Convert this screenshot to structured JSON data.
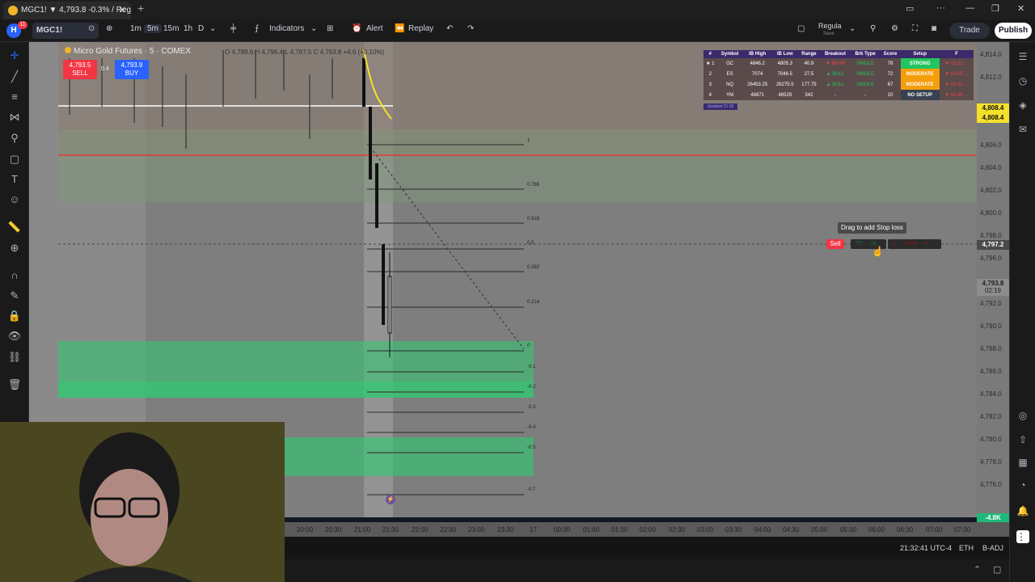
{
  "browser": {
    "tab_title": "MGC1! ▼ 4,793.8 -0.3% / Reg",
    "new_tab": "+",
    "close_tab": "✕"
  },
  "toolbar": {
    "notification_count": "11",
    "symbol": "MGC1!",
    "intervals": [
      "1m",
      "5m",
      "15m",
      "1h",
      "D"
    ],
    "active_interval": "5m",
    "indicators_label": "Indicators",
    "alert_label": "Alert",
    "replay_label": "Replay",
    "layout_name": "Regula",
    "layout_sub": "Save",
    "trade_label": "Trade",
    "publish_label": "Publish"
  },
  "chart_header": {
    "title": "Micro Gold Futures · 5 · COMEX",
    "ohlc": "O 4,789.6 H 4,796.4 L 4,787.5 C 4,793.8 +4.6 (+0.10%)",
    "sell_price": "4,793.5",
    "sell_label": "SELL",
    "spread": "0.4",
    "buy_price": "4,793.9",
    "buy_label": "BUY"
  },
  "ib_table": {
    "headers": [
      "#",
      "Symbol",
      "IB High",
      "IB Low",
      "Range",
      "Breakout",
      "Brk Type",
      "Score",
      "Setup",
      "F"
    ],
    "rows": [
      {
        "n": "★ 1",
        "symbol": "GC",
        "high": "4846.2",
        "low": "4805.3",
        "range": "40.9",
        "breakout": "▼ BEAR",
        "type": "SINGLE",
        "score": "78",
        "setup": "STRONG",
        "last": "▼ 13:31 ..."
      },
      {
        "n": "2",
        "symbol": "ES",
        "high": "7074",
        "low": "7046.5",
        "range": "27.5",
        "breakout": "▲ BULL",
        "type": "SINGLE",
        "score": "72",
        "setup": "MODERATE",
        "last": "▼ 13:05 ..."
      },
      {
        "n": "3",
        "symbol": "NQ",
        "high": "26453.25",
        "low": "26275.5",
        "range": "177.75",
        "breakout": "▲ BULL",
        "type": "SINGLE",
        "score": "67",
        "setup": "MODERATE",
        "last": "▼ 14:12 ..."
      },
      {
        "n": "4",
        "symbol": "YM",
        "high": "48871",
        "low": "48529",
        "range": "342",
        "breakout": "-",
        "type": "-",
        "score": "10",
        "setup": "NO SETUP",
        "last": "▼ 13:46 ..."
      }
    ],
    "updated": "Updated 21:32"
  },
  "fib_levels": [
    "1",
    "0.786",
    "0.618",
    "0.5",
    "0.382",
    "0.214",
    "0",
    "-0.1",
    "-0.2",
    "-0.3",
    "-0.4",
    "-0.5",
    "-0.7"
  ],
  "price_scale": {
    "ticks": [
      "4,814.0",
      "4,812.0",
      "4,808.0",
      "4,806.0",
      "4,804.0",
      "4,802.0",
      "4,800.0",
      "4,798.0",
      "4,796.0",
      "4,794.0",
      "4,792.0",
      "4,790.0",
      "4,788.0",
      "4,786.0",
      "4,784.0",
      "4,782.0",
      "4,780.0",
      "4,778.0",
      "4,776.0"
    ],
    "yellow_label_1": "4,808.4",
    "yellow_label_2": "4,808.4",
    "crosshair_price": "4,797.2",
    "last_price": "4,793.8",
    "countdown": "02:19",
    "volume_label": "-4.8K"
  },
  "time_scale": {
    "ticks": [
      "20:00",
      "20:30",
      "21:00",
      "21:30",
      "22:00",
      "22:30",
      "23:00",
      "23:30",
      "17",
      "00:30",
      "01:00",
      "01:30",
      "02:00",
      "02:30",
      "03:00",
      "03:30",
      "04:00",
      "04:30",
      "05:00",
      "05:30",
      "06:00",
      "06:30",
      "07:00",
      "07:30"
    ]
  },
  "order_panel": {
    "tooltip": "Drag to add Stop loss",
    "sell_label": "Sell",
    "tp_label": "TP",
    "sl_label": "SL",
    "limit_label": "Limit",
    "qty": "1"
  },
  "status": {
    "time": "21:32:41 UTC-4",
    "session": "ETH",
    "adj": "B-ADJ"
  },
  "colors": {
    "sell": "#f23645",
    "buy": "#2962ff",
    "zone_green": "#2ecc71",
    "hline_red": "#e53935",
    "publish_bg": "#ffffff"
  }
}
